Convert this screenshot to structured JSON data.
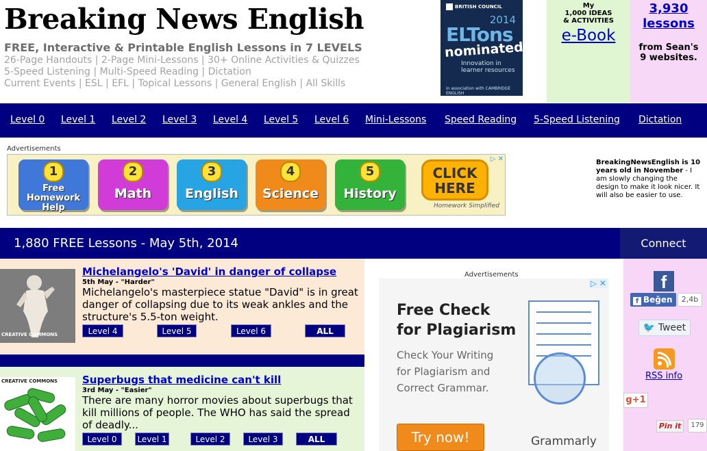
{
  "header": {
    "title": "Breaking News English",
    "tagline": "FREE, Interactive & Printable English Lessons in 7 LEVELS",
    "sublines": [
      "26-Page Handouts | 2-Page Mini-Lessons | 30+ Online Activities & Quizzes",
      "5-Speed Listening | Multi-Speed Reading | Dictation",
      "Current Events | ESL | EFL | Topical Lessons | General English | All Skills"
    ],
    "eltons": {
      "org": "BRITISH COUNCIL",
      "year": "2014",
      "name": "ELTons",
      "nominated": "nominated",
      "line1": "Innovation in",
      "line2": "learner resources",
      "partner": "in association with CAMBRIDGE ENGLISH"
    },
    "ebook": {
      "line1": "My",
      "line2": "1,000 IDEAS",
      "line3": "& ACTIVITIES",
      "link": "e-Book"
    },
    "lessons_box": {
      "count": "3,930",
      "label": "lessons",
      "line1": "from Sean's",
      "line2": "9 websites."
    }
  },
  "nav": {
    "items": [
      "Level 0",
      "Level 1",
      "Level 2",
      "Level 3",
      "Level 4",
      "Level 5",
      "Level 6",
      "Mini-Lessons",
      "Speed Reading",
      "5-Speed Listening",
      "Dictation"
    ]
  },
  "ad_top": {
    "label": "Advertisements",
    "tiles": [
      {
        "num": "1",
        "label": "Free Homework Help"
      },
      {
        "num": "2",
        "label": "Math"
      },
      {
        "num": "3",
        "label": "English"
      },
      {
        "num": "4",
        "label": "Science"
      },
      {
        "num": "5",
        "label": "History"
      }
    ],
    "cta": "CLICK HERE",
    "brand": "Homework Simplified",
    "adchoices": "▷ ✕"
  },
  "note": {
    "bold": "BreakingNewsEnglish is 10 years old in November",
    "rest": " - I am slowly changing the design to make it look nicer. It will also be easier to use."
  },
  "main": {
    "heading": "1,880 FREE Lessons - May 5th, 2014",
    "connect": "Connect"
  },
  "lessons": [
    {
      "title": "Michelangelo's 'David' in danger of collapse",
      "meta": "5th May - \"Harder\"",
      "body": "Michelangelo's masterpiece statue \"David\" is in great danger of collapsing due to its weak ankles and the structure's 5.5-ton weight.",
      "thumb_text": "CREATIVE COMMONS",
      "levels": [
        "Level 4",
        "Level 5",
        "Level 6",
        "ALL"
      ]
    },
    {
      "title": "Superbugs that medicine can't kill",
      "meta": "3rd May - \"Easier\"",
      "body": "There are many horror movies about superbugs that kill millions of people. The WHO has said the spread of deadly...",
      "thumb_text": "CREATIVE COMMONS",
      "levels": [
        "Level 0",
        "Level 1",
        "Level 2",
        "Level 3",
        "ALL"
      ]
    }
  ],
  "ad_middle": {
    "label": "Advertisements",
    "heading1": "Free Check",
    "heading2": "for Plagiarism",
    "sub1": "Check Your Writing",
    "sub2": "for Plagiarism and",
    "sub3": "Correct Grammar.",
    "button": "Try now!",
    "brand": "Grammarly",
    "adchoices": "▷ ✕"
  },
  "social": {
    "fb_letter": "f",
    "like_label": "Beğen",
    "like_count": "2,4b",
    "tweet_label": "Tweet",
    "rss_label": "RSS info",
    "gplus_label": "g+1",
    "pin_label": "Pin it",
    "pin_count": "179"
  },
  "colors": {
    "nav_bg": "#000080",
    "link": "#0000cc",
    "lesson1_bg": "#fce9d6",
    "lesson2_bg": "#e6f5d8",
    "social_bg": "#f7d6f7"
  }
}
